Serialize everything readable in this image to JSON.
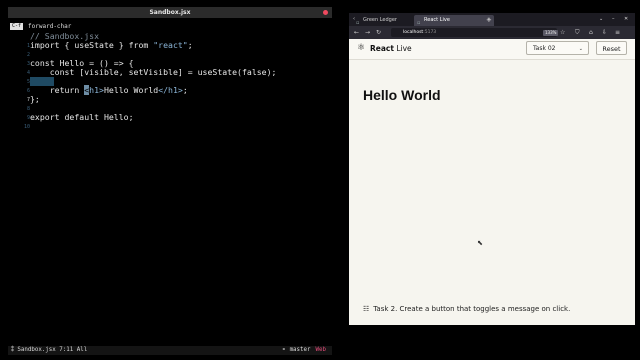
{
  "editor": {
    "title": "Sandbox.jsx",
    "echo_key": "C-f",
    "echo_command": "forward-char",
    "lines": {
      "l1": {
        "num": "1",
        "text": "// Sandbox.jsx"
      },
      "l2": {
        "num": "2",
        "pre": "import { useState } from ",
        "str": "\"react\"",
        "post": ";"
      },
      "l3": {
        "num": "3"
      },
      "l4": {
        "num": "4",
        "text": "const Hello = () => {"
      },
      "l5": {
        "num": "5",
        "text": "    const [visible, setVisible] = useState(false);"
      },
      "l6": {
        "num": "6"
      },
      "l7": {
        "num": "7",
        "pre": "    return ",
        "cursor": "<",
        "tag_open": "h1>",
        "mid": "Hello World",
        "tag_close": "</h1>",
        "post": ";"
      },
      "l8": {
        "num": "8",
        "text": "};"
      },
      "l9": {
        "num": "9"
      },
      "l10": {
        "num": "10",
        "text": "export default Hello;"
      }
    },
    "modeline": {
      "left": "⁑ Sandbox.jsx   7:11 All",
      "branch": "⚬ master",
      "mode": "Web"
    }
  },
  "browser": {
    "tabs": [
      {
        "label": "Green Ledger"
      },
      {
        "label": "React Live"
      }
    ],
    "url_host": "localhost",
    "url_port": ":5173",
    "zoom": "133%",
    "app": {
      "title_bold": "React",
      "title_rest": " Live",
      "task_select": "Task 02",
      "reset_label": "Reset",
      "preview_heading": "Hello World",
      "task_description": "Task 2. Create a button that toggles a message on click."
    }
  },
  "icons": {
    "logo": "react-atom-icon",
    "task": "list-icon",
    "close": "close-icon"
  }
}
